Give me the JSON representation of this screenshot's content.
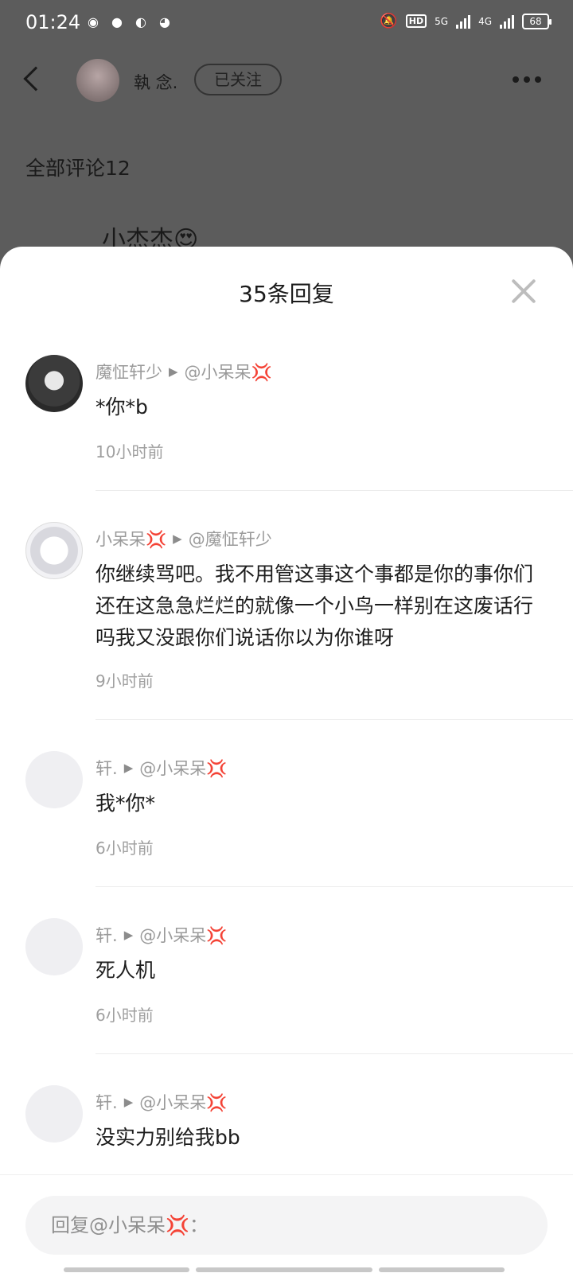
{
  "status_bar": {
    "time": "01:24",
    "battery": "68",
    "network_1": "HD",
    "network_2": "5G",
    "network_3": "4G"
  },
  "header": {
    "author_name": "執 念.",
    "follow_label": "已关注"
  },
  "comments_heading": "全部评论12",
  "peek_comment": "小杰杰😍",
  "sheet": {
    "title": "35条回复",
    "replies": [
      {
        "author": "魔怔轩少",
        "reply_to": "@小呆呆💢",
        "text": "*你*b",
        "time": "10小时前"
      },
      {
        "author": "小呆呆💢",
        "reply_to": "@魔怔轩少",
        "text": "你继续骂吧。我不用管这事这个事都是你的事你们还在这急急烂烂的就像一个小鸟一样别在这废话行吗我又没跟你们说话你以为你谁呀",
        "time": "9小时前"
      },
      {
        "author": "轩.",
        "reply_to": "@小呆呆💢",
        "text": "我*你*",
        "time": "6小时前"
      },
      {
        "author": "轩.",
        "reply_to": "@小呆呆💢",
        "text": "死人机",
        "time": "6小时前"
      },
      {
        "author": "轩.",
        "reply_to": "@小呆呆💢",
        "text": "没实力别给我bb",
        "time": ""
      }
    ]
  },
  "reply_input": {
    "placeholder": "回复@小呆呆💢："
  }
}
